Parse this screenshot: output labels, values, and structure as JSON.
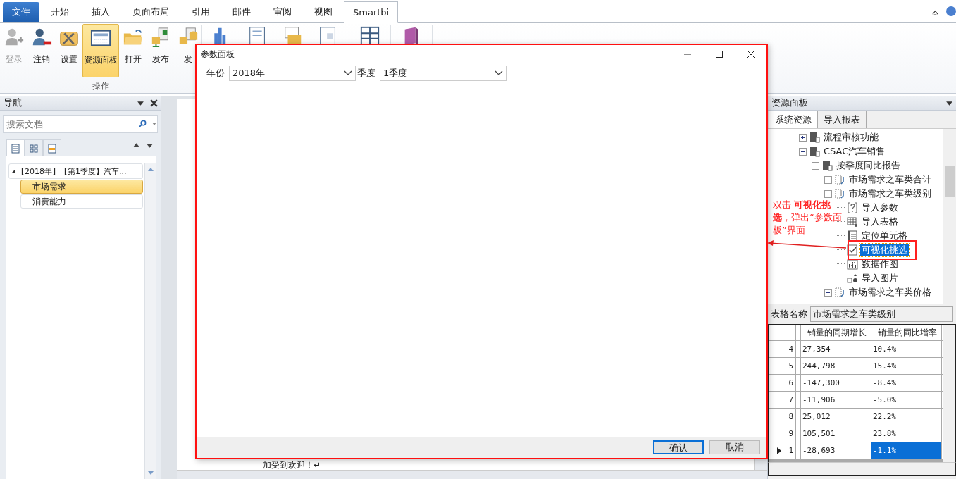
{
  "ribbon": {
    "tabs": [
      {
        "label": "文件",
        "kind": "file",
        "selected": false
      },
      {
        "label": "开始",
        "kind": "tab",
        "selected": false
      },
      {
        "label": "插入",
        "kind": "tab",
        "selected": false
      },
      {
        "label": "页面布局",
        "kind": "tab",
        "selected": false
      },
      {
        "label": "引用",
        "kind": "tab",
        "selected": false
      },
      {
        "label": "邮件",
        "kind": "tab",
        "selected": false
      },
      {
        "label": "审阅",
        "kind": "tab",
        "selected": false
      },
      {
        "label": "视图",
        "kind": "tab",
        "selected": false
      },
      {
        "label": "Smartbi",
        "kind": "tab",
        "selected": true
      }
    ],
    "buttons": [
      {
        "label": "登录",
        "kind": "login",
        "disabled": true,
        "selected": false
      },
      {
        "label": "注销",
        "kind": "logout",
        "disabled": false,
        "selected": false
      },
      {
        "label": "设置",
        "kind": "settings",
        "disabled": false,
        "selected": false
      },
      {
        "label": "资源面板",
        "kind": "panel",
        "disabled": false,
        "selected": true
      },
      {
        "label": "打开",
        "kind": "open",
        "disabled": false,
        "selected": false
      },
      {
        "label": "发布",
        "kind": "publish",
        "disabled": false,
        "selected": false
      },
      {
        "label": "发",
        "kind": "publish-db",
        "disabled": false,
        "selected": false
      }
    ],
    "group_label": "操作"
  },
  "nav": {
    "title": "导航",
    "search": {
      "placeholder": "搜索文档"
    },
    "view_tabs": [
      {
        "kind": "pages",
        "selected": true
      },
      {
        "kind": "thumbs",
        "selected": false
      },
      {
        "kind": "results",
        "selected": false
      }
    ],
    "heading": {
      "label": "【2018年】【第1季度】汽车...",
      "expanded": true
    },
    "items": [
      {
        "label": "市场需求",
        "selected": true
      },
      {
        "label": "消费能力",
        "selected": false
      }
    ]
  },
  "document": {
    "text": "加受到欢迎！↵"
  },
  "resource_panel": {
    "title": "资源面板",
    "tabs": [
      {
        "label": "系统资源",
        "selected": true
      },
      {
        "label": "导入报表",
        "selected": false
      }
    ],
    "tree": [
      {
        "label": "流程审核功能",
        "kind": "folder",
        "expanded": false,
        "selected": false
      },
      {
        "label": "CSAC汽车销售",
        "kind": "folder",
        "expanded": true,
        "selected": false,
        "children": [
          {
            "label": "按季度同比报告",
            "kind": "folder",
            "expanded": true,
            "selected": false,
            "children": [
              {
                "label": "市场需求之车类合计",
                "kind": "report",
                "expanded": false,
                "selected": false
              },
              {
                "label": "市场需求之车类级别",
                "kind": "report",
                "expanded": true,
                "selected": false,
                "children": [
                  {
                    "label": "导入参数",
                    "kind": "param",
                    "selected": false
                  },
                  {
                    "label": "导入表格",
                    "kind": "table",
                    "selected": false
                  },
                  {
                    "label": "定位单元格",
                    "kind": "cell",
                    "selected": false
                  },
                  {
                    "label": "可视化挑选",
                    "kind": "filter",
                    "selected": true
                  },
                  {
                    "label": "数据作图",
                    "kind": "chart",
                    "selected": false
                  },
                  {
                    "label": "导入图片",
                    "kind": "image",
                    "selected": false
                  }
                ]
              },
              {
                "label": "市场需求之车类价格",
                "kind": "report",
                "expanded": false,
                "selected": false
              }
            ]
          }
        ]
      }
    ],
    "table_name": {
      "label": "表格名称",
      "value": "市场需求之车类级别"
    },
    "table": {
      "columns": [
        "销量的同期增长",
        "销量的同比增率"
      ],
      "rows": [
        {
          "header": "4",
          "selected": false,
          "cells": [
            {
              "text": "27,354",
              "selected": false
            },
            {
              "text": "10.4%",
              "selected": false
            }
          ]
        },
        {
          "header": "5",
          "selected": false,
          "cells": [
            {
              "text": "244,798",
              "selected": false
            },
            {
              "text": "15.4%",
              "selected": false
            }
          ]
        },
        {
          "header": "6",
          "selected": false,
          "cells": [
            {
              "text": "-147,300",
              "selected": false
            },
            {
              "text": "-8.4%",
              "selected": false
            }
          ]
        },
        {
          "header": "7",
          "selected": false,
          "cells": [
            {
              "text": "-11,906",
              "selected": false
            },
            {
              "text": "-5.0%",
              "selected": false
            }
          ]
        },
        {
          "header": "8",
          "selected": false,
          "cells": [
            {
              "text": "25,012",
              "selected": false
            },
            {
              "text": "22.2%",
              "selected": false
            }
          ]
        },
        {
          "header": "9",
          "selected": false,
          "cells": [
            {
              "text": "105,501",
              "selected": false
            },
            {
              "text": "23.8%",
              "selected": false
            }
          ]
        },
        {
          "header": "1",
          "selected": true,
          "cells": [
            {
              "text": "-28,693",
              "selected": false
            },
            {
              "text": "-1.1%",
              "selected": true
            }
          ]
        }
      ]
    }
  },
  "dialog": {
    "title": "参数面板",
    "params": [
      {
        "label": "年份",
        "value": "2018年"
      },
      {
        "label": "季度",
        "value": "1季度"
      }
    ],
    "buttons": [
      {
        "label": "确认",
        "default": true
      },
      {
        "label": "取消",
        "default": false
      }
    ]
  },
  "annotation": {
    "text": "双击 **可视化挑选**，弹出“参数面板”界面"
  }
}
